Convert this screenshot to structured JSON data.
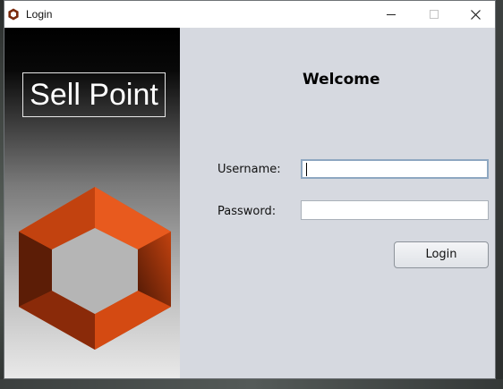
{
  "window": {
    "title": "Login",
    "minimize_icon": "minimize-icon",
    "maximize_icon": "maximize-icon",
    "close_icon": "close-icon"
  },
  "sidebar": {
    "brand": "Sell Point",
    "logo_icon": "hexagon-logo",
    "logo_colors": [
      "#e8501a",
      "#b83a0e",
      "#6a2108"
    ]
  },
  "form": {
    "welcome": "Welcome",
    "username_label": "Username:",
    "username_value": "",
    "password_label": "Password:",
    "password_value": "",
    "login_button": "Login"
  },
  "colors": {
    "form_background": "#d6d9e0",
    "focus_border": "#8ea7c1"
  }
}
